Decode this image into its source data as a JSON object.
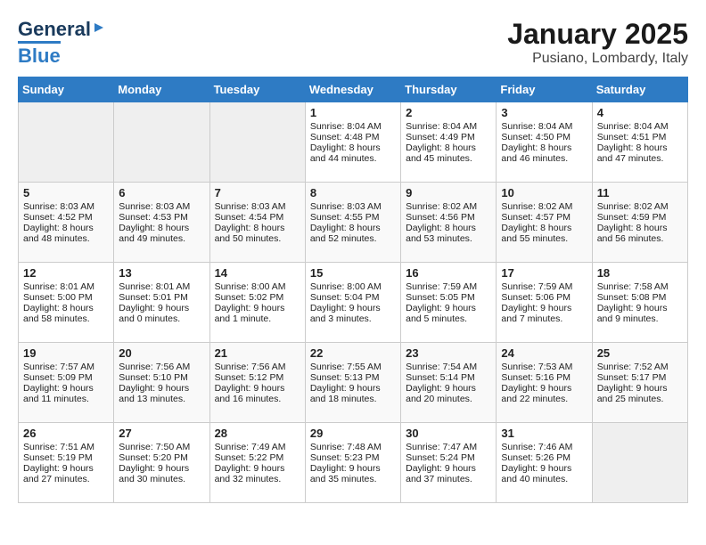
{
  "header": {
    "logo_general": "General",
    "logo_blue": "Blue",
    "month": "January 2025",
    "location": "Pusiano, Lombardy, Italy"
  },
  "days_of_week": [
    "Sunday",
    "Monday",
    "Tuesday",
    "Wednesday",
    "Thursday",
    "Friday",
    "Saturday"
  ],
  "weeks": [
    [
      {
        "day": "",
        "data": ""
      },
      {
        "day": "",
        "data": ""
      },
      {
        "day": "",
        "data": ""
      },
      {
        "day": "1",
        "data": "Sunrise: 8:04 AM\nSunset: 4:48 PM\nDaylight: 8 hours\nand 44 minutes."
      },
      {
        "day": "2",
        "data": "Sunrise: 8:04 AM\nSunset: 4:49 PM\nDaylight: 8 hours\nand 45 minutes."
      },
      {
        "day": "3",
        "data": "Sunrise: 8:04 AM\nSunset: 4:50 PM\nDaylight: 8 hours\nand 46 minutes."
      },
      {
        "day": "4",
        "data": "Sunrise: 8:04 AM\nSunset: 4:51 PM\nDaylight: 8 hours\nand 47 minutes."
      }
    ],
    [
      {
        "day": "5",
        "data": "Sunrise: 8:03 AM\nSunset: 4:52 PM\nDaylight: 8 hours\nand 48 minutes."
      },
      {
        "day": "6",
        "data": "Sunrise: 8:03 AM\nSunset: 4:53 PM\nDaylight: 8 hours\nand 49 minutes."
      },
      {
        "day": "7",
        "data": "Sunrise: 8:03 AM\nSunset: 4:54 PM\nDaylight: 8 hours\nand 50 minutes."
      },
      {
        "day": "8",
        "data": "Sunrise: 8:03 AM\nSunset: 4:55 PM\nDaylight: 8 hours\nand 52 minutes."
      },
      {
        "day": "9",
        "data": "Sunrise: 8:02 AM\nSunset: 4:56 PM\nDaylight: 8 hours\nand 53 minutes."
      },
      {
        "day": "10",
        "data": "Sunrise: 8:02 AM\nSunset: 4:57 PM\nDaylight: 8 hours\nand 55 minutes."
      },
      {
        "day": "11",
        "data": "Sunrise: 8:02 AM\nSunset: 4:59 PM\nDaylight: 8 hours\nand 56 minutes."
      }
    ],
    [
      {
        "day": "12",
        "data": "Sunrise: 8:01 AM\nSunset: 5:00 PM\nDaylight: 8 hours\nand 58 minutes."
      },
      {
        "day": "13",
        "data": "Sunrise: 8:01 AM\nSunset: 5:01 PM\nDaylight: 9 hours\nand 0 minutes."
      },
      {
        "day": "14",
        "data": "Sunrise: 8:00 AM\nSunset: 5:02 PM\nDaylight: 9 hours\nand 1 minute."
      },
      {
        "day": "15",
        "data": "Sunrise: 8:00 AM\nSunset: 5:04 PM\nDaylight: 9 hours\nand 3 minutes."
      },
      {
        "day": "16",
        "data": "Sunrise: 7:59 AM\nSunset: 5:05 PM\nDaylight: 9 hours\nand 5 minutes."
      },
      {
        "day": "17",
        "data": "Sunrise: 7:59 AM\nSunset: 5:06 PM\nDaylight: 9 hours\nand 7 minutes."
      },
      {
        "day": "18",
        "data": "Sunrise: 7:58 AM\nSunset: 5:08 PM\nDaylight: 9 hours\nand 9 minutes."
      }
    ],
    [
      {
        "day": "19",
        "data": "Sunrise: 7:57 AM\nSunset: 5:09 PM\nDaylight: 9 hours\nand 11 minutes."
      },
      {
        "day": "20",
        "data": "Sunrise: 7:56 AM\nSunset: 5:10 PM\nDaylight: 9 hours\nand 13 minutes."
      },
      {
        "day": "21",
        "data": "Sunrise: 7:56 AM\nSunset: 5:12 PM\nDaylight: 9 hours\nand 16 minutes."
      },
      {
        "day": "22",
        "data": "Sunrise: 7:55 AM\nSunset: 5:13 PM\nDaylight: 9 hours\nand 18 minutes."
      },
      {
        "day": "23",
        "data": "Sunrise: 7:54 AM\nSunset: 5:14 PM\nDaylight: 9 hours\nand 20 minutes."
      },
      {
        "day": "24",
        "data": "Sunrise: 7:53 AM\nSunset: 5:16 PM\nDaylight: 9 hours\nand 22 minutes."
      },
      {
        "day": "25",
        "data": "Sunrise: 7:52 AM\nSunset: 5:17 PM\nDaylight: 9 hours\nand 25 minutes."
      }
    ],
    [
      {
        "day": "26",
        "data": "Sunrise: 7:51 AM\nSunset: 5:19 PM\nDaylight: 9 hours\nand 27 minutes."
      },
      {
        "day": "27",
        "data": "Sunrise: 7:50 AM\nSunset: 5:20 PM\nDaylight: 9 hours\nand 30 minutes."
      },
      {
        "day": "28",
        "data": "Sunrise: 7:49 AM\nSunset: 5:22 PM\nDaylight: 9 hours\nand 32 minutes."
      },
      {
        "day": "29",
        "data": "Sunrise: 7:48 AM\nSunset: 5:23 PM\nDaylight: 9 hours\nand 35 minutes."
      },
      {
        "day": "30",
        "data": "Sunrise: 7:47 AM\nSunset: 5:24 PM\nDaylight: 9 hours\nand 37 minutes."
      },
      {
        "day": "31",
        "data": "Sunrise: 7:46 AM\nSunset: 5:26 PM\nDaylight: 9 hours\nand 40 minutes."
      },
      {
        "day": "",
        "data": ""
      }
    ]
  ]
}
